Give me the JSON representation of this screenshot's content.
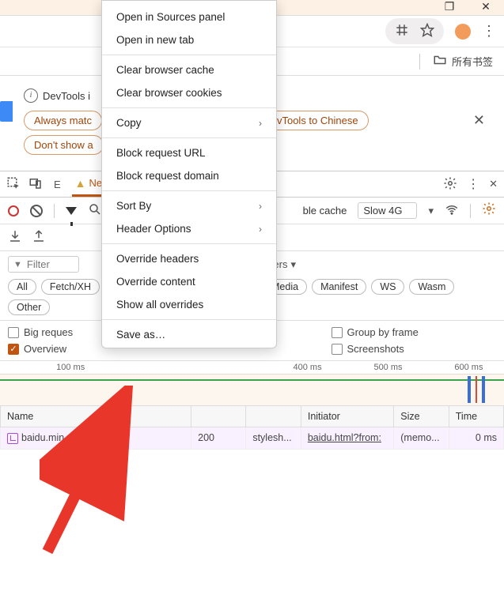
{
  "window": {
    "restore": "❐",
    "close": "✕"
  },
  "bookmarks": {
    "all": "所有书签"
  },
  "prompt": {
    "info_text": "DevTools i",
    "switch_btn": "vTools to Chinese",
    "match_btn": "Always matc",
    "dont_show_btn": "Don't show a"
  },
  "tabs": {
    "elements_initial": "E",
    "network": "Network",
    "more": "»"
  },
  "net_toolbar": {
    "disable_cache": "ble cache",
    "throttle": "Slow 4G"
  },
  "filter": {
    "label": "Filter",
    "more": "ore filters",
    "chips": [
      "All",
      "Fetch/XH",
      "Media",
      "Manifest",
      "WS",
      "Wasm",
      "Other"
    ]
  },
  "checks": {
    "big_requests": "Big reques",
    "overview": "Overview",
    "group_frame": "Group by frame",
    "screenshots": "Screenshots"
  },
  "timeline": {
    "ticks": [
      {
        "label": "100 ms",
        "pct": 14
      },
      {
        "label": "400 ms",
        "pct": 61
      },
      {
        "label": "500 ms",
        "pct": 77
      },
      {
        "label": "600 ms",
        "pct": 93
      }
    ]
  },
  "table": {
    "headers": {
      "name": "Name",
      "status": "",
      "type": "",
      "initiator": "Initiator",
      "size": "Size",
      "time": "Time"
    },
    "row": {
      "name": "baidu.min.c",
      "status": "200",
      "type": "stylesh...",
      "initiator": "baidu.html?from:",
      "size": "(memo...",
      "time": "0 ms"
    }
  },
  "ctx": {
    "open_sources": "Open in Sources panel",
    "open_tab": "Open in new tab",
    "clear_cache": "Clear browser cache",
    "clear_cookies": "Clear browser cookies",
    "copy": "Copy",
    "block_url": "Block request URL",
    "block_domain": "Block request domain",
    "sort_by": "Sort By",
    "header_options": "Header Options",
    "override_headers": "Override headers",
    "override_content": "Override content",
    "show_overrides": "Show all overrides",
    "save_as": "Save as…"
  }
}
